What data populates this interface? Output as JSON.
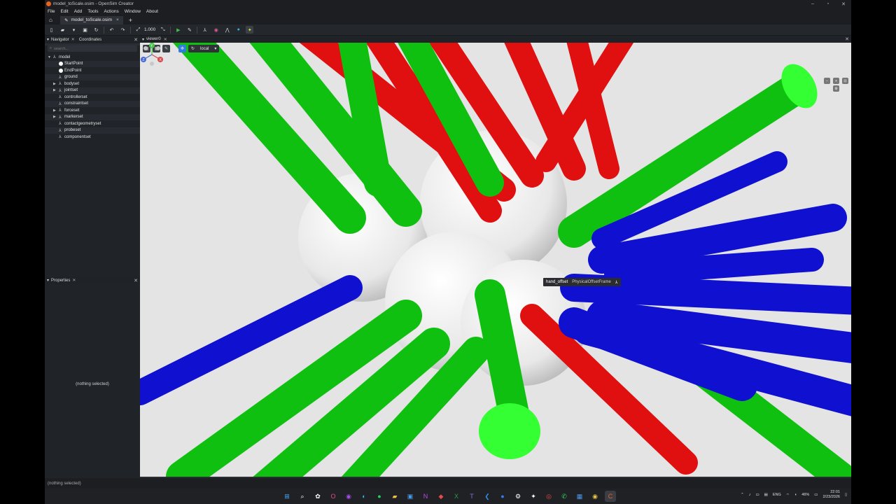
{
  "window": {
    "title": "model_toScale.osim - OpenSim Creator",
    "min": "–",
    "max": "▫",
    "close": "✕"
  },
  "menu": [
    "File",
    "Edit",
    "Add",
    "Tools",
    "Actions",
    "Window",
    "About"
  ],
  "tabs": {
    "file_tab": "model_toScale.osim",
    "close": "×",
    "add": "+"
  },
  "toolbar": {
    "scale_value": "1.000"
  },
  "navigator": {
    "tab_label": "Navigator",
    "coordinates_label": "Coordinates",
    "search_placeholder": "search...",
    "tree": [
      {
        "label": "model",
        "icon": "component-icon",
        "expanded": true,
        "level": 0
      },
      {
        "label": "StartPoint",
        "icon": "point-icon",
        "level": 1
      },
      {
        "label": "EndPoint",
        "icon": "point-icon",
        "level": 1
      },
      {
        "label": "ground",
        "icon": "frame-icon",
        "level": 1
      },
      {
        "label": "bodyset",
        "icon": "component-icon",
        "collapsed": true,
        "level": 1
      },
      {
        "label": "jointset",
        "icon": "component-icon",
        "collapsed": true,
        "level": 1
      },
      {
        "label": "controllerset",
        "icon": "component-icon",
        "level": 1
      },
      {
        "label": "constraintset",
        "icon": "component-icon",
        "level": 1
      },
      {
        "label": "forceset",
        "icon": "component-icon",
        "collapsed": true,
        "level": 1
      },
      {
        "label": "markerset",
        "icon": "component-icon",
        "collapsed": true,
        "level": 1
      },
      {
        "label": "contactgeometryset",
        "icon": "component-icon",
        "level": 1
      },
      {
        "label": "probeset",
        "icon": "component-icon",
        "level": 1
      },
      {
        "label": "componentset",
        "icon": "component-icon",
        "level": 1
      }
    ]
  },
  "properties": {
    "tab_label": "Properties",
    "empty_text": "(nothing selected)"
  },
  "viewer": {
    "tab_label": "viewer0",
    "frame_mode": "local",
    "hover": {
      "name": "hand_offset",
      "type": "PhysicalOffsetFrame"
    },
    "colors": {
      "x": "#e01010",
      "y": "#10c010",
      "z": "#1010d0",
      "background": "#e4e4e4"
    }
  },
  "status": {
    "text": "(nothing selected)"
  },
  "taskbar": {
    "lang": "ENG",
    "battery": "46%",
    "time": "22:01",
    "date": "2/23/2026"
  }
}
